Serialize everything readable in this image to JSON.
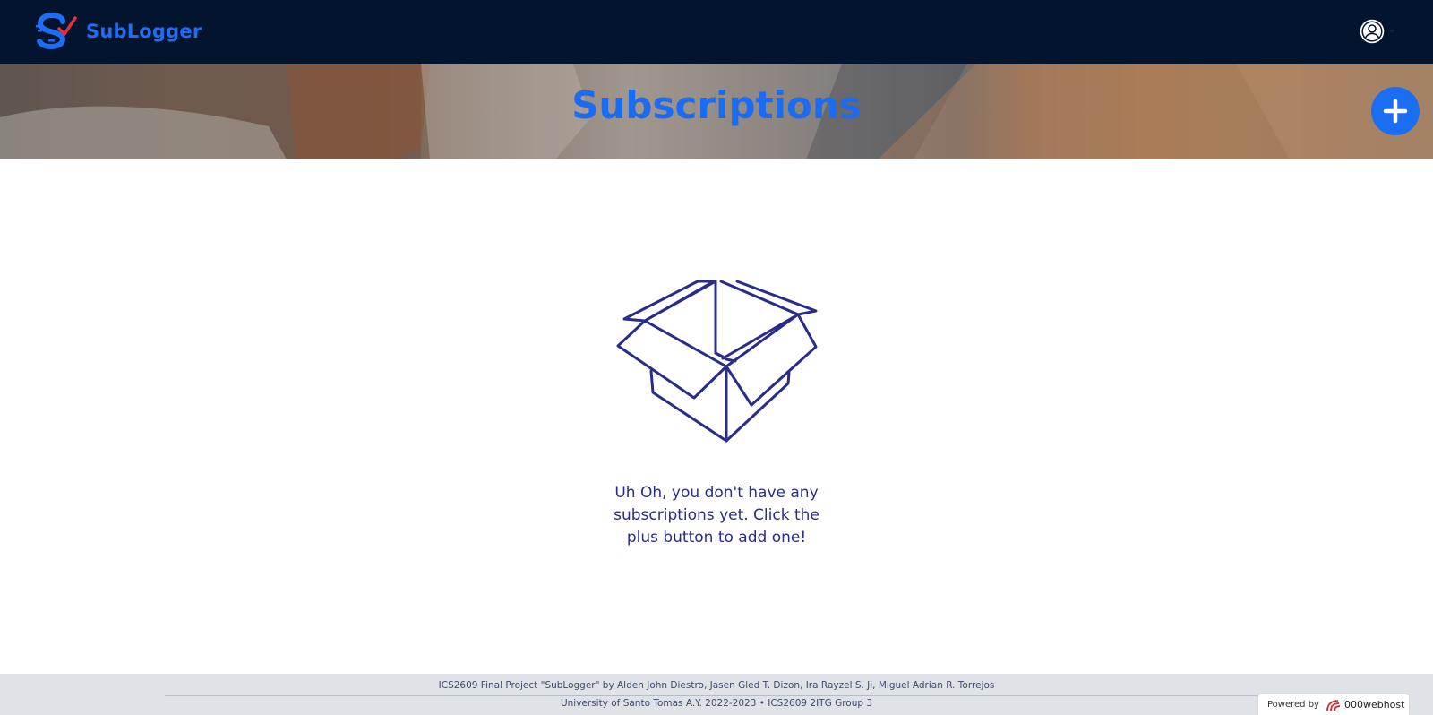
{
  "navbar": {
    "brand_name": "SubLogger",
    "account_icon": "user-circle-icon"
  },
  "hero": {
    "title": "Subscriptions",
    "add_icon": "plus-icon"
  },
  "empty_state": {
    "icon": "open-box-icon",
    "message": "Uh Oh, you don't have any subscriptions yet. Click the plus button to add one!"
  },
  "footer": {
    "line1": "ICS2609 Final Project \"SubLogger\" by Alden John Diestro, Jasen Gled T. Dizon, Ira Rayzel S. Ji, Miguel Adrian R. Torrejos",
    "line2": "University of Santo Tomas A.Y. 2022-2023 • ICS2609 2ITG Group 3"
  },
  "host_badge": {
    "powered_label": "Powered by",
    "host_name": "000webhost"
  },
  "colors": {
    "navbar_bg": "#03142e",
    "accent": "#1a6ef2",
    "empty_state": "#2a2c8c",
    "footer_bg": "#dfe2e7"
  }
}
